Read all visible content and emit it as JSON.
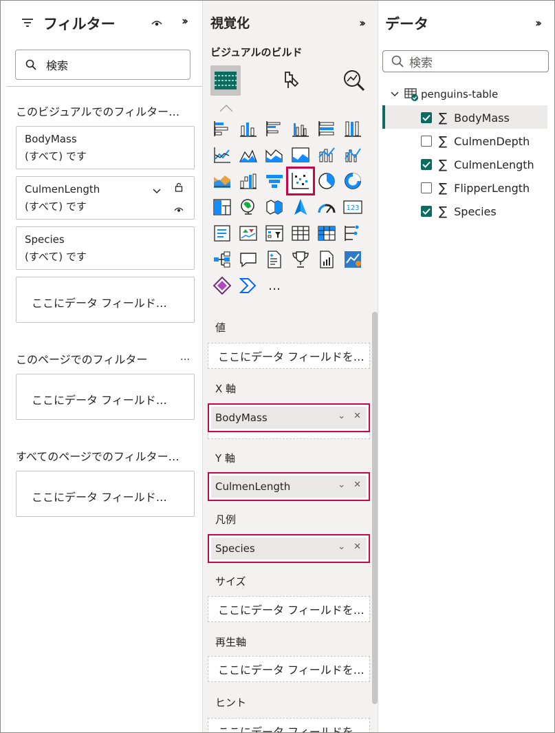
{
  "filters": {
    "title": "フィルター",
    "search_placeholder": "検索",
    "visual_section": "このビジュアルでのフィルター…",
    "cards": [
      {
        "field": "BodyMass",
        "value": "(すべて) です"
      },
      {
        "field": "CulmenLength",
        "value": "(すべて) です"
      },
      {
        "field": "Species",
        "value": "(すべて) です"
      }
    ],
    "drop_placeholder": "ここにデータ フィールド…",
    "page_section": "このページでのフィルター",
    "page_section_more": "…",
    "all_pages_section": "すべてのページでのフィルター…"
  },
  "viz": {
    "title": "視覚化",
    "subtitle": "ビジュアルのビルド",
    "more_label": "…",
    "wells": [
      {
        "label": "値",
        "placeholder": "ここにデータ フィールドを…"
      },
      {
        "label": "X 軸",
        "field": "BodyMass"
      },
      {
        "label": "Y 軸",
        "field": "CulmenLength"
      },
      {
        "label": "凡例",
        "field": "Species"
      },
      {
        "label": "サイズ",
        "placeholder": "ここにデータ フィールドを…"
      },
      {
        "label": "再生軸",
        "placeholder": "ここにデータ フィールドを…"
      },
      {
        "label": "ヒント",
        "placeholder": "ここにデータ フィールドを…"
      }
    ]
  },
  "data": {
    "title": "データ",
    "search_placeholder": "検索",
    "table_name": "penguins-table",
    "fields": [
      {
        "name": "BodyMass",
        "checked": true
      },
      {
        "name": "CulmenDepth",
        "checked": false
      },
      {
        "name": "CulmenLength",
        "checked": true
      },
      {
        "name": "FlipperLength",
        "checked": false
      },
      {
        "name": "Species",
        "checked": true
      }
    ],
    "sigma": "∑"
  },
  "colors": {
    "accent_teal": "#0e6b5f",
    "highlight": "#c7074d"
  }
}
